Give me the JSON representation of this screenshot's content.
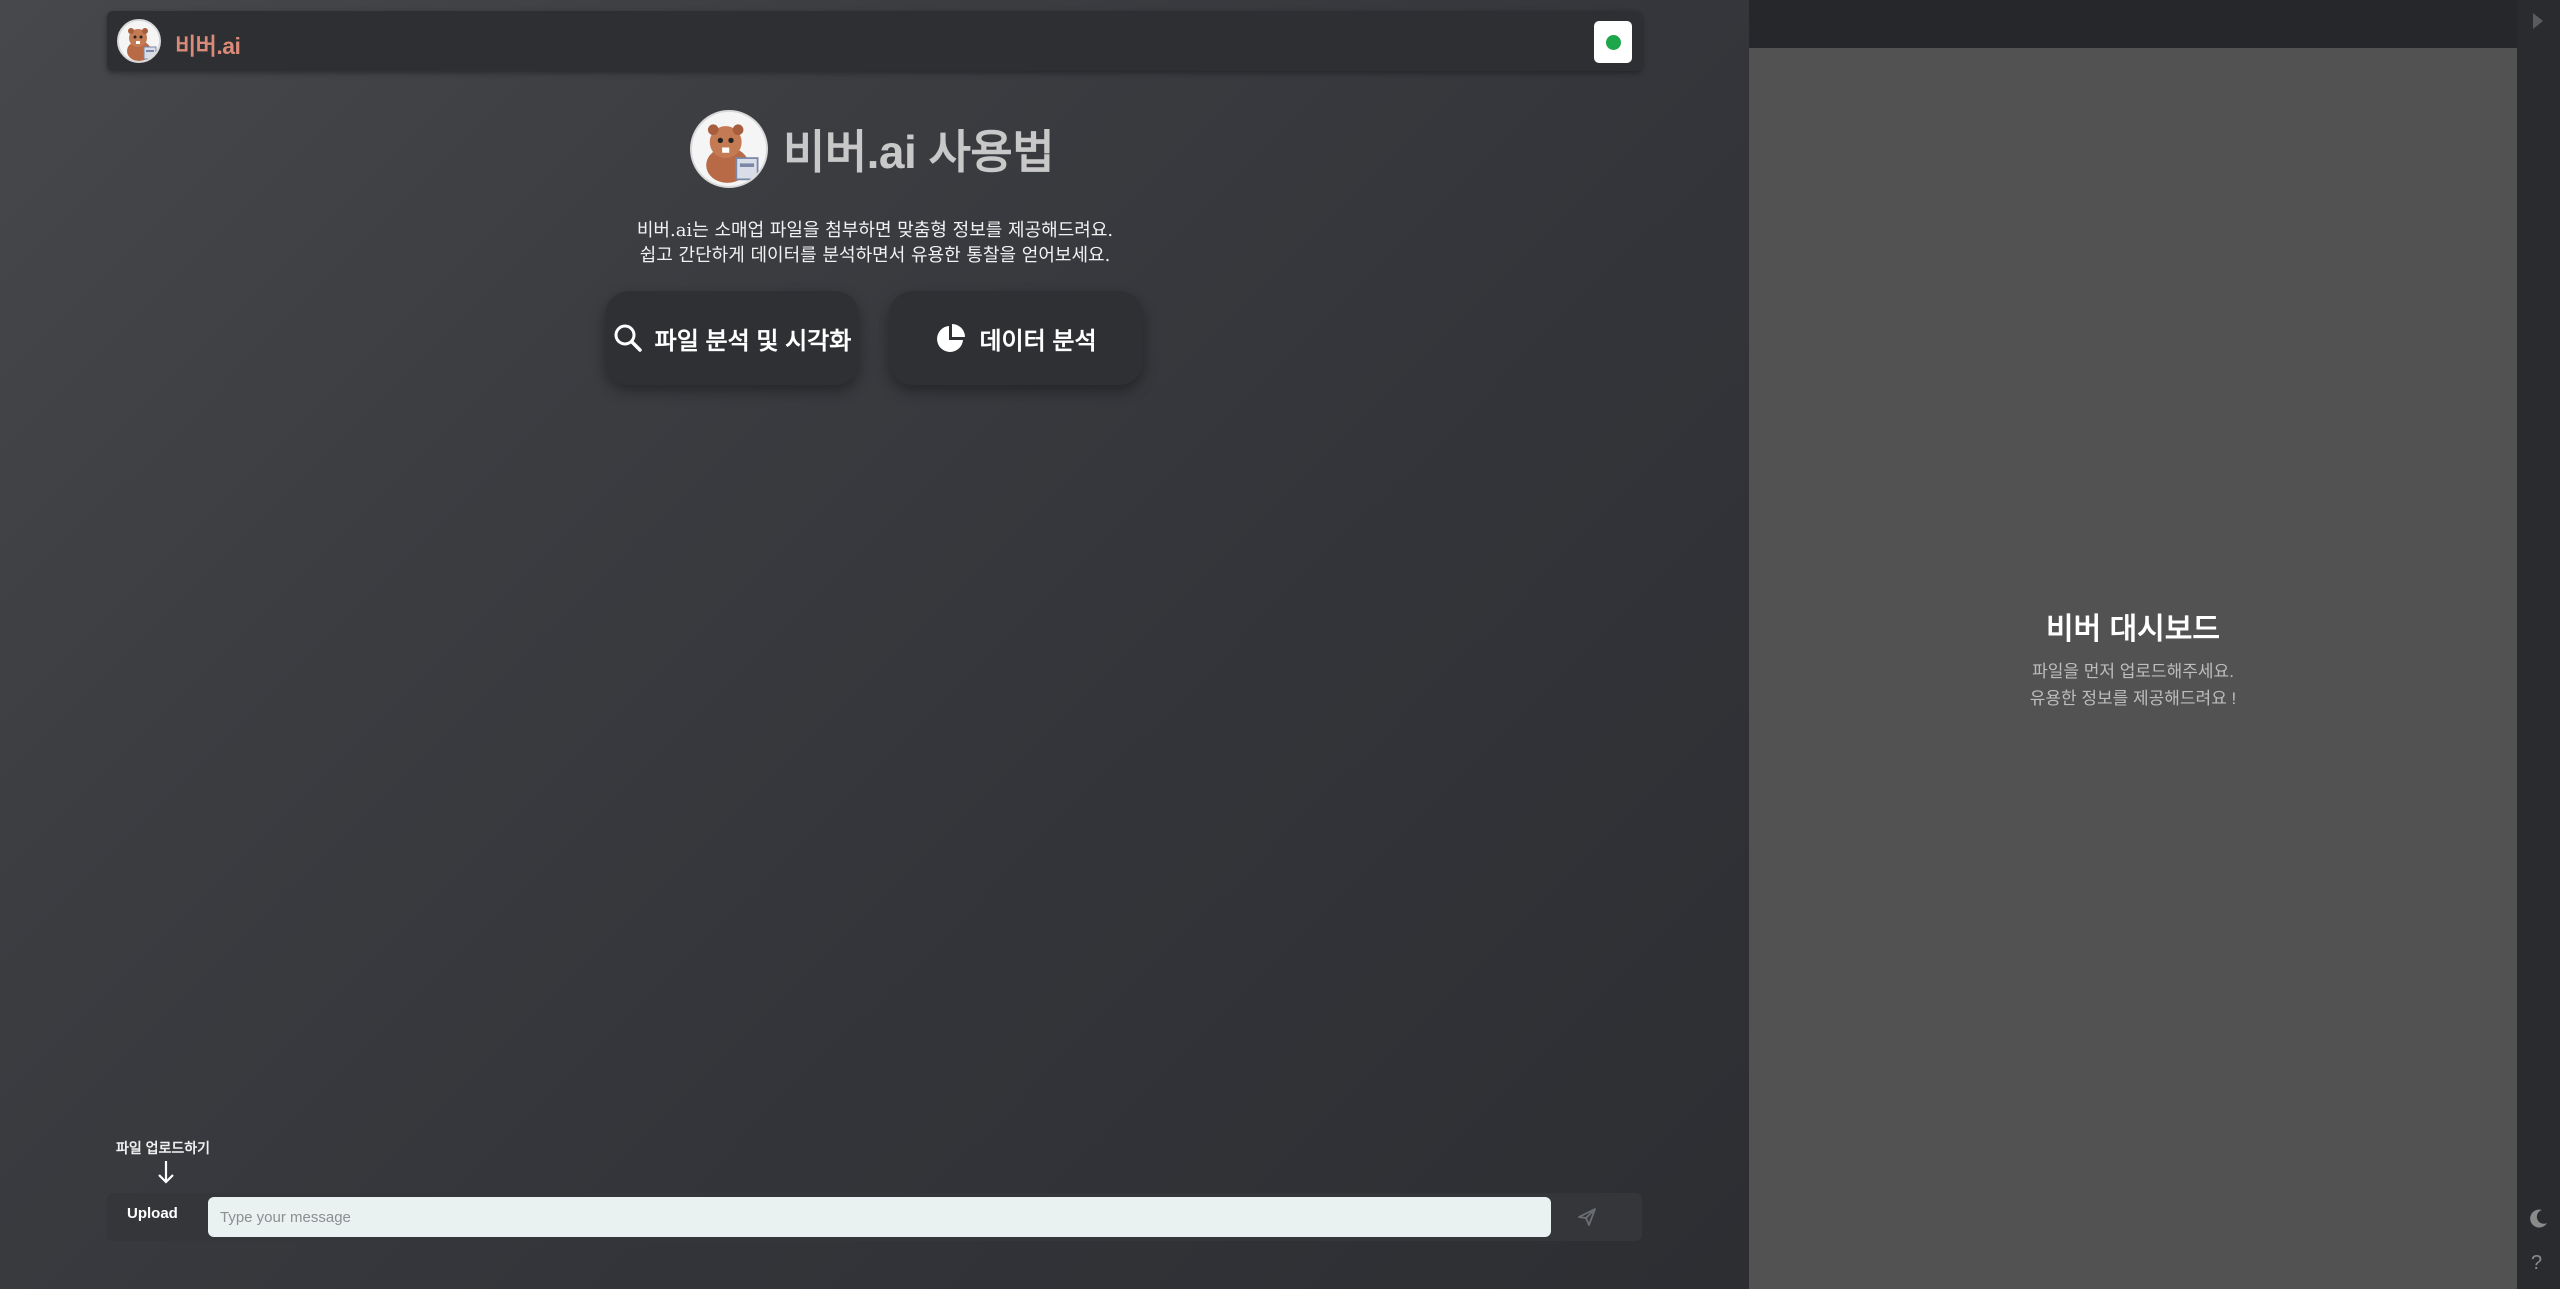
{
  "header": {
    "brand": "비버.ai"
  },
  "hero": {
    "title": "비버.ai 사용법",
    "desc_line1": "비버.ai는 소매업 파일을 첨부하면 맞춤형 정보를 제공해드려요.",
    "desc_line2": "쉽고 간단하게 데이터를 분석하면서 유용한 통찰을 얻어보세요."
  },
  "features": {
    "analyze_label": "파일 분석 및 시각화",
    "data_label": "데이터 분석"
  },
  "composer": {
    "upload_hint": "파일 업로드하기",
    "upload_label": "Upload",
    "placeholder": "Type your message"
  },
  "dashboard": {
    "title": "비버 대시보드",
    "subtitle1": "파일을 먼저 업로드해주세요.",
    "subtitle2": "유용한 정보를 제공해드려요 !"
  },
  "rail": {
    "help": "?"
  },
  "colors": {
    "brand": "#d98a78",
    "status": "#1ea64a",
    "panel": "#525252"
  },
  "icons": [
    "beaver-logo-icon",
    "status-dot-icon",
    "search-icon",
    "pie-chart-icon",
    "arrow-down-icon",
    "send-icon",
    "collapse-right-icon",
    "moon-icon",
    "help-icon"
  ]
}
